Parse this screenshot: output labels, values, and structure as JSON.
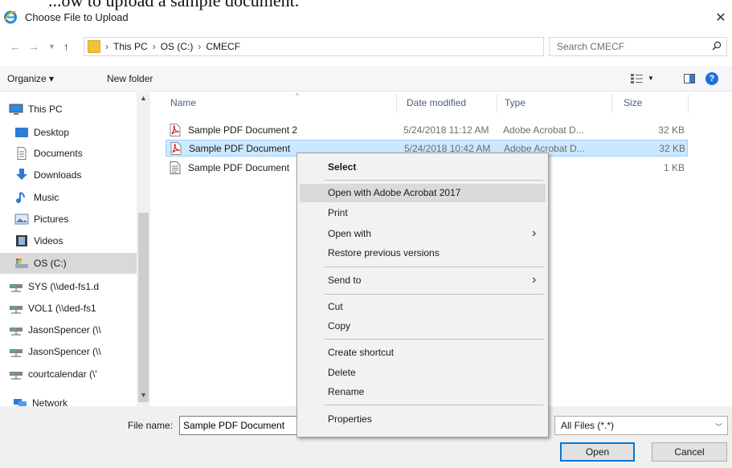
{
  "overlay_text": "...ow to upload a sample document.",
  "window": {
    "title": "Choose File to Upload"
  },
  "address": {
    "crumbs": [
      "This PC",
      "OS (C:)",
      "CMECF"
    ],
    "separator": "›",
    "search_placeholder": "Search CMECF"
  },
  "toolbar": {
    "organize": "Organize ▾",
    "new_folder": "New folder",
    "help": "?"
  },
  "nav": {
    "items": [
      {
        "label": "This PC",
        "icon": "computer-icon"
      },
      {
        "label": "Desktop",
        "icon": "desktop-icon"
      },
      {
        "label": "Documents",
        "icon": "documents-icon"
      },
      {
        "label": "Downloads",
        "icon": "downloads-icon"
      },
      {
        "label": "Music",
        "icon": "music-icon"
      },
      {
        "label": "Pictures",
        "icon": "pictures-icon"
      },
      {
        "label": "Videos",
        "icon": "videos-icon"
      },
      {
        "label": "OS (C:)",
        "icon": "drive-icon"
      },
      {
        "label": "SYS (\\\\ded-fs1.d",
        "icon": "network-drive-icon"
      },
      {
        "label": "VOL1 (\\\\ded-fs1",
        "icon": "network-drive-icon"
      },
      {
        "label": "JasonSpencer (\\\\",
        "icon": "network-drive-icon"
      },
      {
        "label": "JasonSpencer (\\\\",
        "icon": "network-drive-icon"
      },
      {
        "label": "courtcalendar (\\'",
        "icon": "network-drive-icon"
      },
      {
        "label": "Network",
        "icon": "network-icon"
      }
    ]
  },
  "columns": {
    "name": "Name",
    "date": "Date modified",
    "type": "Type",
    "size": "Size"
  },
  "files": [
    {
      "name": "Sample PDF Document 2",
      "date": "5/24/2018 11:12 AM",
      "type": "Adobe Acrobat D...",
      "size": "32 KB",
      "icon": "pdf-icon"
    },
    {
      "name": "Sample PDF Document",
      "date": "5/24/2018 10:42 AM",
      "type": "Adobe Acrobat D...",
      "size": "32 KB",
      "icon": "pdf-icon"
    },
    {
      "name": "Sample PDF Document",
      "date": "",
      "type": "cument",
      "size": "1 KB",
      "icon": "text-file-icon"
    }
  ],
  "context_menu": {
    "select": "Select",
    "open_with_acrobat": "Open with Adobe Acrobat 2017",
    "print": "Print",
    "open_with": "Open with",
    "restore": "Restore previous versions",
    "send_to": "Send to",
    "cut": "Cut",
    "copy": "Copy",
    "create_shortcut": "Create shortcut",
    "delete": "Delete",
    "rename": "Rename",
    "properties": "Properties",
    "submenu_arrow": "›"
  },
  "bottom": {
    "file_name_label": "File name:",
    "file_name_value": "Sample PDF Document",
    "file_type": "All Files (*.*)",
    "open": "Open",
    "cancel": "Cancel"
  },
  "colors": {
    "accent": "#0078d7",
    "selection": "#cce8ff",
    "menu_bg": "#f2f2f2"
  }
}
